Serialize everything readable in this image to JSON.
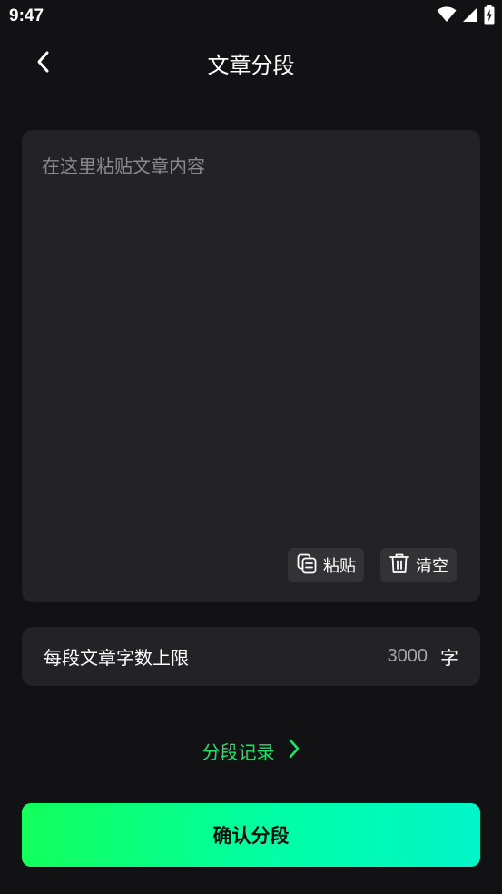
{
  "status_bar": {
    "time": "9:47"
  },
  "header": {
    "title": "文章分段",
    "back_icon": "chevron-left-icon"
  },
  "editor": {
    "placeholder": "在这里粘贴文章内容",
    "value": "",
    "paste_label": "粘贴",
    "clear_label": "清空"
  },
  "limit": {
    "label": "每段文章字数上限",
    "value": "3000",
    "unit": "字"
  },
  "history": {
    "label": "分段记录"
  },
  "confirm": {
    "label": "确认分段"
  },
  "colors": {
    "background": "#121214",
    "card": "#232325",
    "accent_green": "#20e26a",
    "button_gradient_start": "#12ff5a",
    "button_gradient_end": "#00f5c8"
  }
}
